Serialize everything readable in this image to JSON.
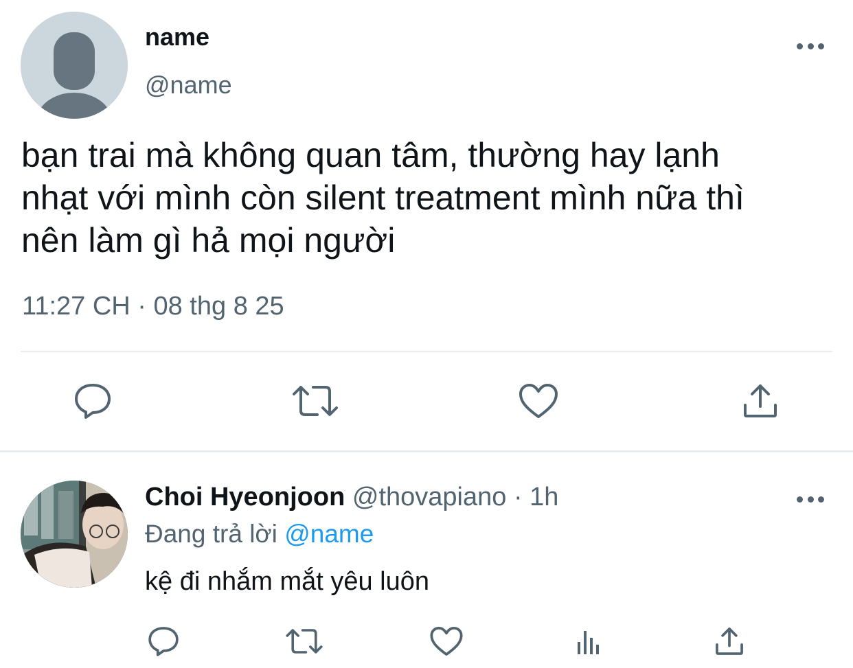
{
  "tweet": {
    "author": {
      "display_name": "name",
      "handle": "@name",
      "avatar_icon": "default-avatar-icon"
    },
    "text": "bạn trai mà không quan tâm, thường hay lạnh\nnhạt với mình còn silent treatment mình nữa thì\nnên làm gì hả mọi người",
    "timestamp": "11:27 CH · 08 thg 8 25",
    "actions": [
      "reply-icon",
      "retweet-icon",
      "like-icon",
      "share-icon"
    ]
  },
  "reply": {
    "author": {
      "display_name": "Choi Hyeonjoon",
      "handle": "@thovapiano",
      "separator": "·",
      "time": "1h"
    },
    "replying_prefix": "Đang trả lời",
    "replying_to": "@name",
    "text": "kệ đi nhắm mắt yêu luôn",
    "actions": [
      "reply-icon",
      "retweet-icon",
      "like-icon",
      "analytics-icon",
      "share-icon"
    ]
  },
  "colors": {
    "text": "#0f1419",
    "secondary": "#536471",
    "accent": "#1d9bf0",
    "divider": "#e6ecf0"
  }
}
